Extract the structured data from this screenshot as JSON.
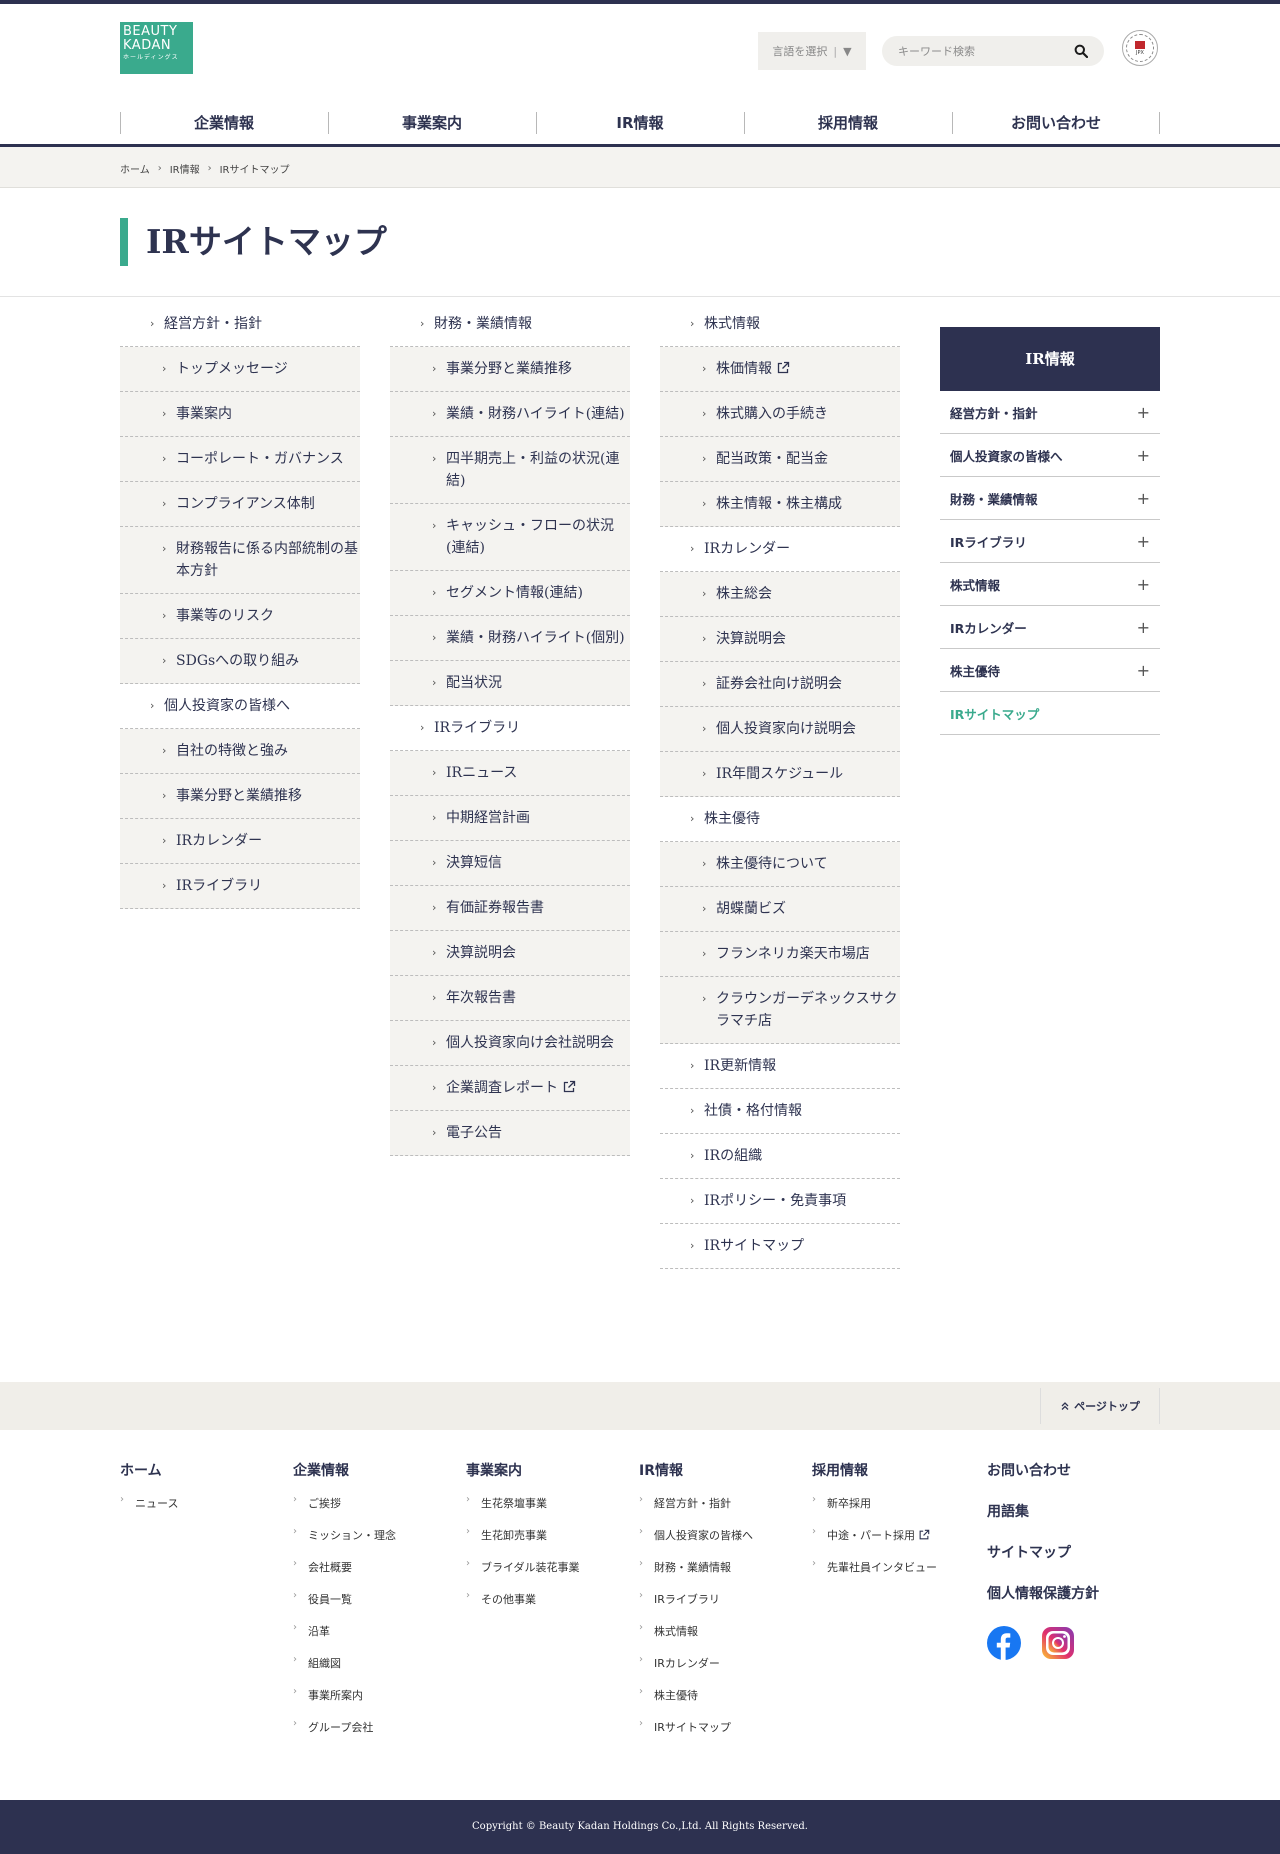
{
  "logo": {
    "line1": "BEAUTY",
    "line2": "KADAN",
    "line3": "ホールディングス"
  },
  "header": {
    "lang_label": "言語を選択",
    "lang_caret": "▼",
    "search_placeholder": "キーワード検索",
    "badge_text": "JPX"
  },
  "gnav": [
    {
      "label": "企業情報",
      "active": false
    },
    {
      "label": "事業案内",
      "active": false
    },
    {
      "label": "IR情報",
      "active": true
    },
    {
      "label": "採用情報",
      "active": false
    },
    {
      "label": "お問い合わせ",
      "active": false
    }
  ],
  "breadcrumb": [
    "ホーム",
    "IR情報",
    "IRサイトマップ"
  ],
  "page_title": "IRサイトマップ",
  "columns": [
    [
      {
        "label": "経営方針・指針",
        "level": "top"
      },
      {
        "label": "トップメッセージ",
        "level": "sub"
      },
      {
        "label": "事業案内",
        "level": "sub"
      },
      {
        "label": "コーポレート・ガバナンス",
        "level": "sub"
      },
      {
        "label": "コンプライアンス体制",
        "level": "sub"
      },
      {
        "label": "財務報告に係る内部統制の基本方針",
        "level": "sub"
      },
      {
        "label": "事業等のリスク",
        "level": "sub"
      },
      {
        "label": "SDGsへの取り組み",
        "level": "sub"
      },
      {
        "label": "個人投資家の皆様へ",
        "level": "top"
      },
      {
        "label": "自社の特徴と強み",
        "level": "sub"
      },
      {
        "label": "事業分野と業績推移",
        "level": "sub"
      },
      {
        "label": "IRカレンダー",
        "level": "sub"
      },
      {
        "label": "IRライブラリ",
        "level": "sub"
      }
    ],
    [
      {
        "label": "財務・業績情報",
        "level": "top"
      },
      {
        "label": "事業分野と業績推移",
        "level": "sub"
      },
      {
        "label": "業績・財務ハイライト(連結)",
        "level": "sub"
      },
      {
        "label": "四半期売上・利益の状況(連結)",
        "level": "sub"
      },
      {
        "label": "キャッシュ・フローの状況(連結)",
        "level": "sub"
      },
      {
        "label": "セグメント情報(連結)",
        "level": "sub"
      },
      {
        "label": "業績・財務ハイライト(個別)",
        "level": "sub"
      },
      {
        "label": "配当状況",
        "level": "sub"
      },
      {
        "label": "IRライブラリ",
        "level": "top"
      },
      {
        "label": "IRニュース",
        "level": "sub"
      },
      {
        "label": "中期経営計画",
        "level": "sub"
      },
      {
        "label": "決算短信",
        "level": "sub"
      },
      {
        "label": "有価証券報告書",
        "level": "sub"
      },
      {
        "label": "決算説明会",
        "level": "sub"
      },
      {
        "label": "年次報告書",
        "level": "sub"
      },
      {
        "label": "個人投資家向け会社説明会",
        "level": "sub"
      },
      {
        "label": "企業調査レポート",
        "level": "sub",
        "external": true
      },
      {
        "label": "電子公告",
        "level": "sub"
      }
    ],
    [
      {
        "label": "株式情報",
        "level": "top"
      },
      {
        "label": "株価情報",
        "level": "sub",
        "external": true
      },
      {
        "label": "株式購入の手続き",
        "level": "sub"
      },
      {
        "label": "配当政策・配当金",
        "level": "sub"
      },
      {
        "label": "株主情報・株主構成",
        "level": "sub"
      },
      {
        "label": "IRカレンダー",
        "level": "top"
      },
      {
        "label": "株主総会",
        "level": "sub"
      },
      {
        "label": "決算説明会",
        "level": "sub"
      },
      {
        "label": "証券会社向け説明会",
        "level": "sub"
      },
      {
        "label": "個人投資家向け説明会",
        "level": "sub"
      },
      {
        "label": "IR年間スケジュール",
        "level": "sub"
      },
      {
        "label": "株主優待",
        "level": "top"
      },
      {
        "label": "株主優待について",
        "level": "sub"
      },
      {
        "label": "胡蝶蘭ビズ",
        "level": "sub"
      },
      {
        "label": "フランネリカ楽天市場店",
        "level": "sub"
      },
      {
        "label": "クラウンガーデネックスサクラマチ店",
        "level": "sub"
      },
      {
        "label": "IR更新情報",
        "level": "top"
      },
      {
        "label": "社債・格付情報",
        "level": "top"
      },
      {
        "label": "IRの組織",
        "level": "top"
      },
      {
        "label": "IRポリシー・免責事項",
        "level": "top"
      },
      {
        "label": "IRサイトマップ",
        "level": "top"
      }
    ]
  ],
  "sidebar": {
    "title": "IR情報",
    "items": [
      {
        "label": "経営方針・指針",
        "expand": "+"
      },
      {
        "label": "個人投資家の皆様へ",
        "expand": "+"
      },
      {
        "label": "財務・業績情報",
        "expand": "+"
      },
      {
        "label": "IRライブラリ",
        "expand": "+"
      },
      {
        "label": "株式情報",
        "expand": "+"
      },
      {
        "label": "IRカレンダー",
        "expand": "+"
      },
      {
        "label": "株主優待",
        "expand": "+"
      },
      {
        "label": "IRサイトマップ",
        "expand": "",
        "active": true
      }
    ]
  },
  "page_top": "ページトップ",
  "footer_cols": [
    {
      "heading": "ホーム",
      "links": [
        {
          "label": "ニュース"
        }
      ]
    },
    {
      "heading": "企業情報",
      "links": [
        {
          "label": "ご挨拶"
        },
        {
          "label": "ミッション・理念"
        },
        {
          "label": "会社概要"
        },
        {
          "label": "役員一覧"
        },
        {
          "label": "沿革"
        },
        {
          "label": "組織図"
        },
        {
          "label": "事業所案内"
        },
        {
          "label": "グループ会社"
        }
      ]
    },
    {
      "heading": "事業案内",
      "links": [
        {
          "label": "生花祭壇事業"
        },
        {
          "label": "生花卸売事業"
        },
        {
          "label": "ブライダル装花事業"
        },
        {
          "label": "その他事業"
        }
      ]
    },
    {
      "heading": "IR情報",
      "links": [
        {
          "label": "経営方針・指針"
        },
        {
          "label": "個人投資家の皆様へ"
        },
        {
          "label": "財務・業績情報"
        },
        {
          "label": "IRライブラリ"
        },
        {
          "label": "株式情報"
        },
        {
          "label": "IRカレンダー"
        },
        {
          "label": "株主優待"
        },
        {
          "label": "IRサイトマップ"
        }
      ]
    },
    {
      "heading": "採用情報",
      "links": [
        {
          "label": "新卒採用"
        },
        {
          "label": "中途・パート採用",
          "external": true
        },
        {
          "label": "先輩社員インタビュー"
        }
      ]
    }
  ],
  "footer_side": [
    "お問い合わせ",
    "用語集",
    "サイトマップ",
    "個人情報保護方針"
  ],
  "social": [
    "facebook-icon",
    "instagram-icon"
  ],
  "copyright": "Copyright © Beauty Kadan Holdings Co.,Ltd. All Rights Reserved.",
  "colors": {
    "navy": "#2d3150",
    "accent": "#3aaa8d",
    "band": "#f4f3f0"
  }
}
